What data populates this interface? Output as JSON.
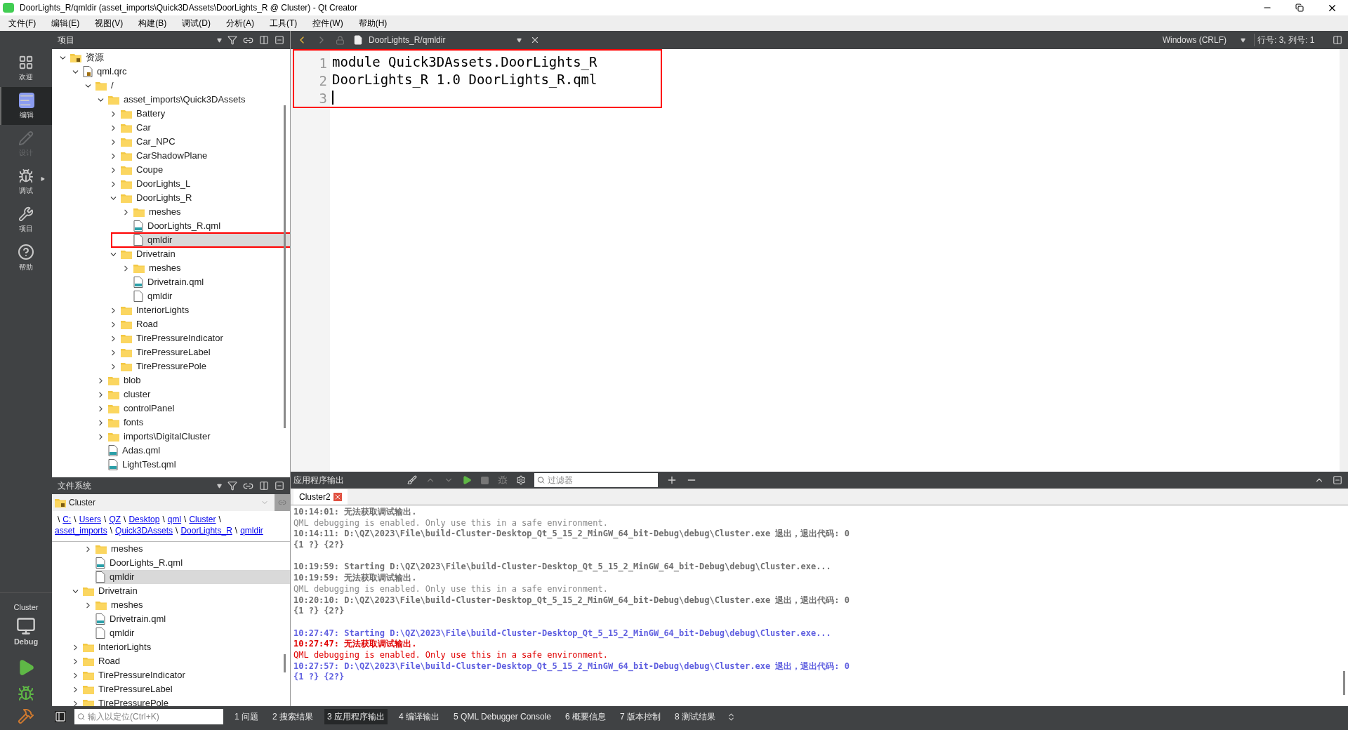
{
  "window": {
    "title": "DoorLights_R/qmldir (asset_imports\\Quick3DAssets\\DoorLights_R @ Cluster) - Qt Creator"
  },
  "menu": [
    "文件(F)",
    "编辑(E)",
    "视图(V)",
    "构建(B)",
    "调试(D)",
    "分析(A)",
    "工具(T)",
    "控件(W)",
    "帮助(H)"
  ],
  "modes": [
    {
      "label": "欢迎",
      "selected": false,
      "disabled": false
    },
    {
      "label": "编辑",
      "selected": true,
      "disabled": false
    },
    {
      "label": "设计",
      "selected": false,
      "disabled": true
    },
    {
      "label": "调试",
      "selected": false,
      "disabled": false
    },
    {
      "label": "项目",
      "selected": false,
      "disabled": false
    },
    {
      "label": "帮助",
      "selected": false,
      "disabled": false
    }
  ],
  "kit": {
    "project": "Cluster",
    "build": "Debug"
  },
  "project_pane": {
    "title": "项目",
    "tree": [
      {
        "label": "资源",
        "kind": "resource",
        "expanded": true,
        "children": [
          {
            "label": "qml.qrc",
            "kind": "qrc",
            "expanded": true,
            "children": [
              {
                "label": "/",
                "kind": "folder",
                "expanded": true,
                "children": [
                  {
                    "label": "asset_imports\\Quick3DAssets",
                    "kind": "folder",
                    "expanded": true,
                    "children": [
                      {
                        "label": "Battery",
                        "kind": "folder",
                        "expanded": false
                      },
                      {
                        "label": "Car",
                        "kind": "folder",
                        "expanded": false
                      },
                      {
                        "label": "Car_NPC",
                        "kind": "folder",
                        "expanded": false
                      },
                      {
                        "label": "CarShadowPlane",
                        "kind": "folder",
                        "expanded": false
                      },
                      {
                        "label": "Coupe",
                        "kind": "folder",
                        "expanded": false
                      },
                      {
                        "label": "DoorLights_L",
                        "kind": "folder",
                        "expanded": false
                      },
                      {
                        "label": "DoorLights_R",
                        "kind": "folder",
                        "expanded": true,
                        "children": [
                          {
                            "label": "meshes",
                            "kind": "folder",
                            "expanded": false
                          },
                          {
                            "label": "DoorLights_R.qml",
                            "kind": "qml"
                          },
                          {
                            "label": "qmldir",
                            "kind": "file",
                            "selected": true,
                            "highlighted": true
                          }
                        ]
                      },
                      {
                        "label": "Drivetrain",
                        "kind": "folder",
                        "expanded": true,
                        "children": [
                          {
                            "label": "meshes",
                            "kind": "folder",
                            "expanded": false
                          },
                          {
                            "label": "Drivetrain.qml",
                            "kind": "qml"
                          },
                          {
                            "label": "qmldir",
                            "kind": "file",
                            "selected": false
                          }
                        ]
                      },
                      {
                        "label": "InteriorLights",
                        "kind": "folder",
                        "expanded": false
                      },
                      {
                        "label": "Road",
                        "kind": "folder",
                        "expanded": false
                      },
                      {
                        "label": "TirePressureIndicator",
                        "kind": "folder",
                        "expanded": false
                      },
                      {
                        "label": "TirePressureLabel",
                        "kind": "folder",
                        "expanded": false
                      },
                      {
                        "label": "TirePressurePole",
                        "kind": "folder",
                        "expanded": false
                      }
                    ]
                  },
                  {
                    "label": "blob",
                    "kind": "folder",
                    "expanded": false
                  },
                  {
                    "label": "cluster",
                    "kind": "folder",
                    "expanded": false
                  },
                  {
                    "label": "controlPanel",
                    "kind": "folder",
                    "expanded": false
                  },
                  {
                    "label": "fonts",
                    "kind": "folder",
                    "expanded": false
                  },
                  {
                    "label": "imports\\DigitalCluster",
                    "kind": "folder",
                    "expanded": false
                  },
                  {
                    "label": "Adas.qml",
                    "kind": "qml"
                  },
                  {
                    "label": "LightTest.qml",
                    "kind": "qml"
                  }
                ]
              }
            ]
          }
        ]
      }
    ]
  },
  "filesystem_pane": {
    "title": "文件系统",
    "root": "Cluster",
    "path": [
      {
        "kind": "separator",
        "text": "\\"
      },
      {
        "kind": "link",
        "text": "C:"
      },
      {
        "kind": "separator",
        "text": "\\"
      },
      {
        "kind": "link",
        "text": "Users"
      },
      {
        "kind": "separator",
        "text": "\\"
      },
      {
        "kind": "link",
        "text": "QZ"
      },
      {
        "kind": "separator",
        "text": "\\"
      },
      {
        "kind": "link",
        "text": "Desktop"
      },
      {
        "kind": "separator",
        "text": "\\"
      },
      {
        "kind": "link",
        "text": "qml"
      },
      {
        "kind": "separator",
        "text": "\\"
      },
      {
        "kind": "link",
        "text": "Cluster"
      },
      {
        "kind": "separator",
        "text": "\\"
      },
      {
        "kind": "break"
      },
      {
        "kind": "link",
        "text": "asset_imports"
      },
      {
        "kind": "separator",
        "text": "\\"
      },
      {
        "kind": "link",
        "text": "Quick3DAssets"
      },
      {
        "kind": "separator",
        "text": "\\"
      },
      {
        "kind": "link",
        "text": "DoorLights_R"
      },
      {
        "kind": "separator",
        "text": "\\"
      },
      {
        "kind": "link",
        "text": "qmldir"
      }
    ],
    "tree": [
      {
        "children": [
          {
            "label": "meshes",
            "kind": "folder",
            "expanded": false
          },
          {
            "label": "DoorLights_R.qml",
            "kind": "qml"
          },
          {
            "label": "qmldir",
            "kind": "file",
            "selected": true
          }
        ]
      },
      {
        "label": "Drivetrain",
        "kind": "folder",
        "expanded": true,
        "children": [
          {
            "label": "meshes",
            "kind": "folder",
            "expanded": false
          },
          {
            "label": "Drivetrain.qml",
            "kind": "qml"
          },
          {
            "label": "qmldir",
            "kind": "file",
            "selected": false
          }
        ]
      },
      {
        "label": "InteriorLights",
        "kind": "folder",
        "expanded": false
      },
      {
        "label": "Road",
        "kind": "folder",
        "expanded": false
      },
      {
        "label": "TirePressureIndicator",
        "kind": "folder",
        "expanded": false
      },
      {
        "label": "TirePressureLabel",
        "kind": "folder",
        "expanded": false
      },
      {
        "label": "TirePressurePole",
        "kind": "folder",
        "expanded": false
      }
    ]
  },
  "editor": {
    "document": "DoorLights_R/qmldir",
    "line_ending": "Windows (CRLF)",
    "position": "行号: 3, 列号: 1",
    "highlighted": true,
    "lines": [
      {
        "number": "1",
        "code": "module Quick3DAssets.DoorLights_R",
        "cursor": false
      },
      {
        "number": "2",
        "code": "DoorLights_R 1.0 DoorLights_R.qml",
        "cursor": false
      },
      {
        "number": "3",
        "cursor": true
      }
    ]
  },
  "output_pane": {
    "title": "应用程序输出",
    "filter_placeholder": "过滤器",
    "tab": "Cluster2",
    "lines": [
      {
        "kind": "text",
        "text": "10:14:01: 无法获取调试输出.",
        "color": "#6e6e6e",
        "bold": true
      },
      {
        "kind": "text",
        "text": "QML debugging is enabled. Only use this in a safe environment.",
        "color": "#8a8a8a",
        "bold": false
      },
      {
        "kind": "text",
        "text": "10:14:11: D:\\QZ\\2023\\File\\build-Cluster-Desktop_Qt_5_15_2_MinGW_64_bit-Debug\\debug\\Cluster.exe 退出，退出代码: 0",
        "color": "#6e6e6e",
        "bold": true
      },
      {
        "kind": "text",
        "text": "{1 ?} {2?}",
        "color": "#6e6e6e",
        "bold": true
      },
      {
        "kind": "blank"
      },
      {
        "kind": "text",
        "text": "10:19:59: Starting D:\\QZ\\2023\\File\\build-Cluster-Desktop_Qt_5_15_2_MinGW_64_bit-Debug\\debug\\Cluster.exe...",
        "color": "#6e6e6e",
        "bold": true
      },
      {
        "kind": "text",
        "text": "10:19:59: 无法获取调试输出.",
        "color": "#6e6e6e",
        "bold": true
      },
      {
        "kind": "text",
        "text": "QML debugging is enabled. Only use this in a safe environment.",
        "color": "#8a8a8a",
        "bold": false
      },
      {
        "kind": "text",
        "text": "10:20:10: D:\\QZ\\2023\\File\\build-Cluster-Desktop_Qt_5_15_2_MinGW_64_bit-Debug\\debug\\Cluster.exe 退出，退出代码: 0",
        "color": "#6e6e6e",
        "bold": true
      },
      {
        "kind": "text",
        "text": "{1 ?} {2?}",
        "color": "#6e6e6e",
        "bold": true
      },
      {
        "kind": "blank"
      },
      {
        "kind": "text",
        "text": "10:27:47: Starting D:\\QZ\\2023\\File\\build-Cluster-Desktop_Qt_5_15_2_MinGW_64_bit-Debug\\debug\\Cluster.exe...",
        "color": "#5f5fe0",
        "bold": true
      },
      {
        "kind": "text",
        "text": "10:27:47: 无法获取调试输出.",
        "color": "#e00000",
        "bold": true
      },
      {
        "kind": "text",
        "text": "QML debugging is enabled. Only use this in a safe environment.",
        "color": "#e00000",
        "bold": false
      },
      {
        "kind": "text",
        "text": "10:27:57: D:\\QZ\\2023\\File\\build-Cluster-Desktop_Qt_5_15_2_MinGW_64_bit-Debug\\debug\\Cluster.exe 退出，退出代码: 0",
        "color": "#5f5fe0",
        "bold": true
      },
      {
        "kind": "text",
        "text": "{1 ?} {2?}",
        "color": "#5f5fe0",
        "bold": true
      }
    ]
  },
  "status_bar": {
    "locator_placeholder": "输入以定位(Ctrl+K)",
    "tabs": [
      {
        "label": "1 问题",
        "selected": false
      },
      {
        "label": "2 搜索结果",
        "selected": false
      },
      {
        "label": "3 应用程序输出",
        "selected": true
      },
      {
        "label": "4 编译输出",
        "selected": false
      },
      {
        "label": "5 QML Debugger Console",
        "selected": false
      },
      {
        "label": "6 概要信息",
        "selected": false
      },
      {
        "label": "7 版本控制",
        "selected": false
      },
      {
        "label": "8 测试结果",
        "selected": false
      }
    ]
  }
}
